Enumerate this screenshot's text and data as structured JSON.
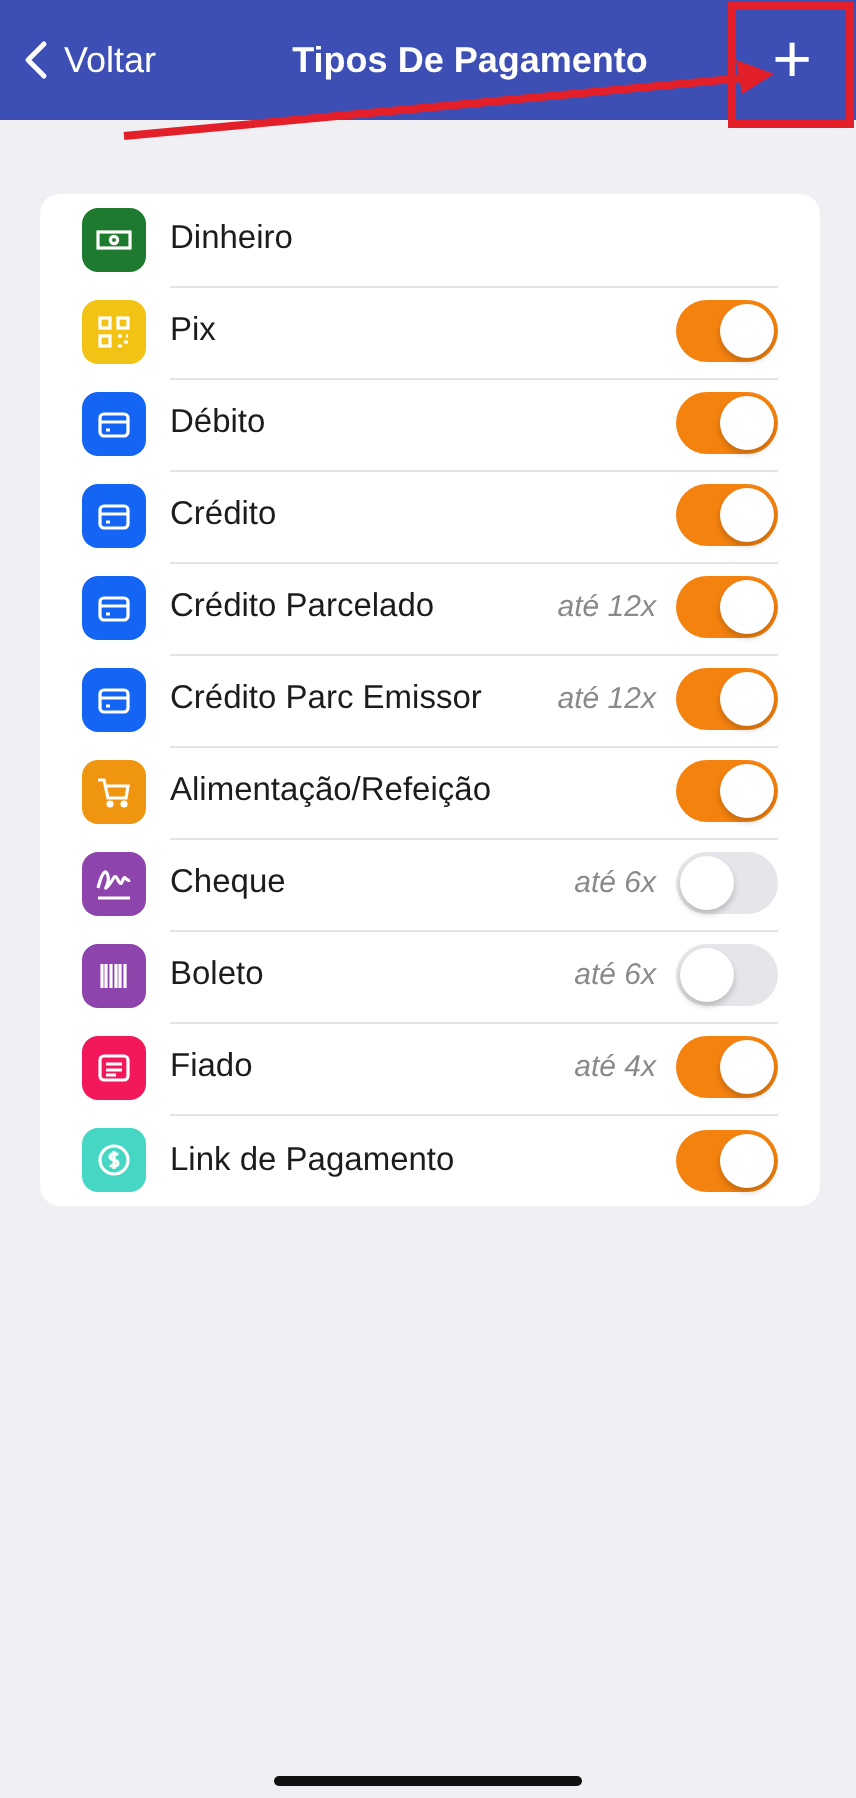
{
  "nav_bar": {
    "back_label": "Voltar",
    "title": "Tipos De Pagamento",
    "add_button": "+"
  },
  "payment_types": [
    {
      "label": "Dinheiro",
      "kind": "cash",
      "color": "#1e7a2e"
    },
    {
      "label": "Pix",
      "kind": "qr",
      "color": "#f2c315",
      "on": true
    },
    {
      "label": "Débito",
      "kind": "card",
      "color": "#1565f5",
      "on": true
    },
    {
      "label": "Crédito",
      "kind": "card",
      "color": "#1565f5",
      "on": true
    },
    {
      "label": "Crédito Parcelado",
      "kind": "card",
      "color": "#1565f5",
      "installments": "até 12x",
      "on": true
    },
    {
      "label": "Crédito Parc Emissor",
      "kind": "card",
      "color": "#1565f5",
      "installments": "até 12x",
      "on": true
    },
    {
      "label": "Alimentação/Refeição",
      "kind": "cart",
      "color": "#f0950f",
      "on": true
    },
    {
      "label": "Cheque",
      "kind": "signature",
      "color": "#8e44ad",
      "installments": "até 6x",
      "on": false
    },
    {
      "label": "Boleto",
      "kind": "barcode",
      "color": "#8e44ad",
      "installments": "até 6x",
      "on": false
    },
    {
      "label": "Fiado",
      "kind": "ledger",
      "color": "#f2185a",
      "installments": "até 4x",
      "on": true
    },
    {
      "label": "Link de Pagamento",
      "kind": "coin",
      "color": "#45d6c4",
      "on": true
    }
  ]
}
